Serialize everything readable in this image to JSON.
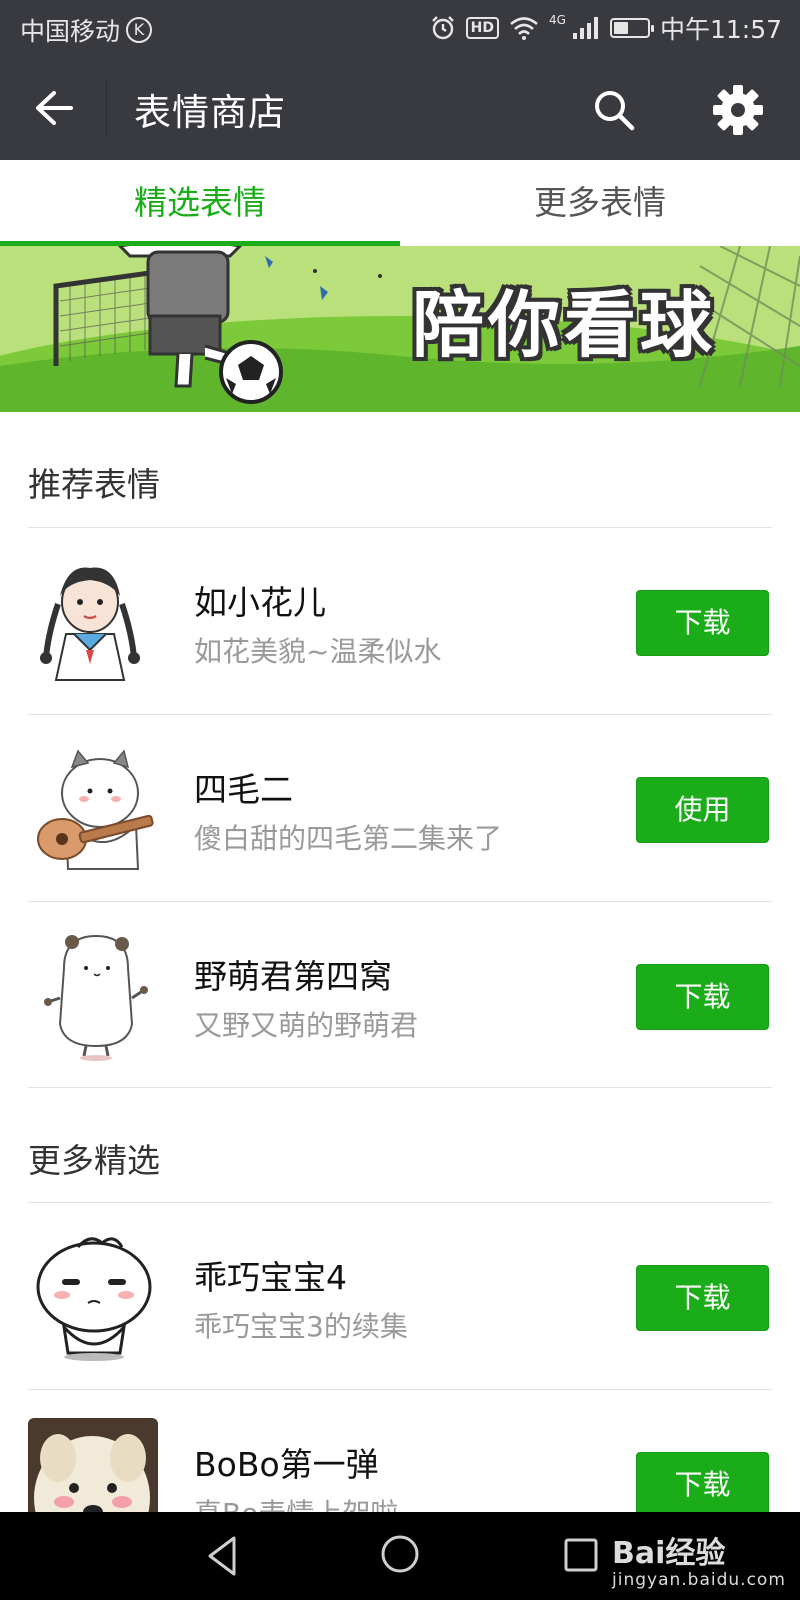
{
  "status_bar": {
    "carrier": "中国移动",
    "carrier_badge": "K",
    "hd_label": "HD",
    "network": "4G",
    "time": "中午11:57",
    "battery_level": 0.45,
    "icons": [
      "alarm-icon",
      "wifi-icon",
      "signal-icon",
      "battery-icon"
    ]
  },
  "appbar": {
    "title": "表情商店",
    "icons": [
      "back-arrow-icon",
      "search-icon",
      "gear-icon"
    ]
  },
  "tabs": [
    {
      "label": "精选表情",
      "active": true
    },
    {
      "label": "更多表情",
      "active": false
    }
  ],
  "banner": {
    "text": "陪你看球"
  },
  "sections": [
    {
      "header": "推荐表情",
      "items": [
        {
          "name": "如小花儿",
          "desc": "如花美貌~温柔似水",
          "button": "下载"
        },
        {
          "name": "四毛二",
          "desc": "傻白甜的四毛第二集来了",
          "button": "使用"
        },
        {
          "name": "野萌君第四窝",
          "desc": "又野又萌的野萌君",
          "button": "下载"
        }
      ]
    },
    {
      "header": "更多精选",
      "items": [
        {
          "name": "乖巧宝宝4",
          "desc": "乖巧宝宝3的续集",
          "button": "下载"
        },
        {
          "name": "BoBo第一弹",
          "desc": "真Bo表情上架啦",
          "button": "下载"
        }
      ]
    }
  ],
  "colors": {
    "accent": "#1aad19",
    "appbar": "#393a3f",
    "navbar": "#000000"
  },
  "watermark": {
    "main": "Bai经验",
    "sub": "jingyan.baidu.com"
  }
}
